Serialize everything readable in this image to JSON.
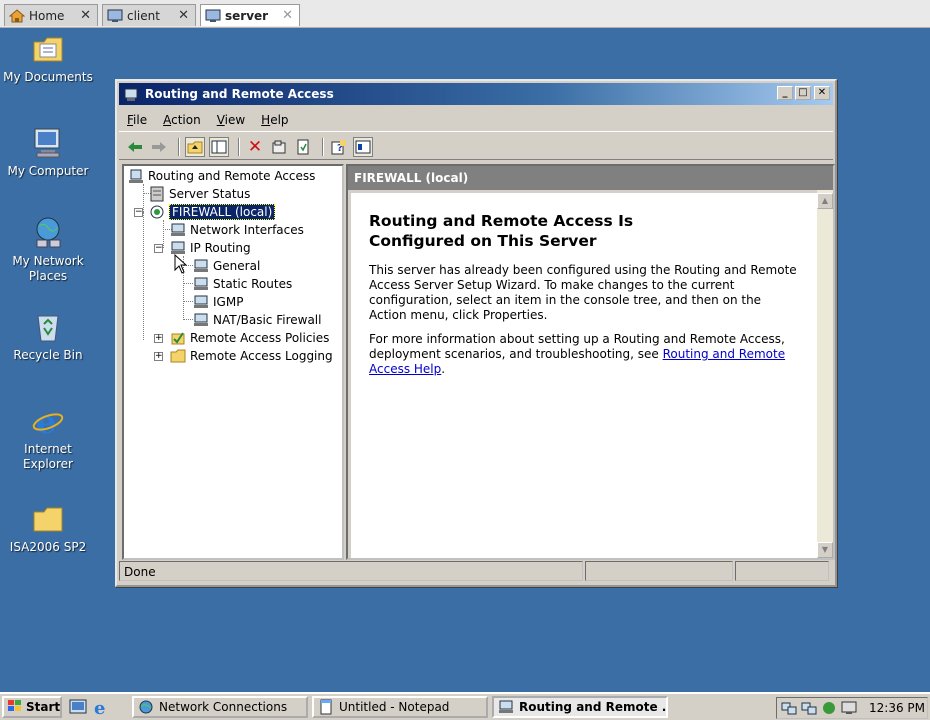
{
  "vm_tabs": [
    {
      "label": "Home",
      "icon": "home-icon",
      "active": false
    },
    {
      "label": "client",
      "icon": "vm-icon",
      "active": false
    },
    {
      "label": "server",
      "icon": "vm-icon",
      "active": true
    }
  ],
  "desktop_icons": [
    {
      "label": "My Documents",
      "icon": "folder-documents-icon"
    },
    {
      "label": "My Computer",
      "icon": "computer-icon"
    },
    {
      "label": "My Network Places",
      "icon": "network-icon"
    },
    {
      "label": "Recycle Bin",
      "icon": "recycle-bin-icon"
    },
    {
      "label": "Internet Explorer",
      "icon": "internet-explorer-icon"
    },
    {
      "label": "ISA2006 SP2",
      "icon": "folder-icon"
    }
  ],
  "window": {
    "title": "Routing and Remote Access",
    "menu": [
      "File",
      "Action",
      "View",
      "Help"
    ],
    "toolbar": [
      "back-arrow-icon",
      "forward-arrow-icon",
      "up-folder-icon",
      "show-hide-tree-icon",
      "delete-icon",
      "properties-icon",
      "export-list-icon",
      "help-icon",
      "console-tree-icon"
    ]
  },
  "tree": {
    "root": "Routing and Remote Access",
    "server_status": "Server Status",
    "server": "FIREWALL (local)",
    "network_interfaces": "Network Interfaces",
    "ip_routing": "IP Routing",
    "general": "General",
    "static_routes": "Static Routes",
    "igmp": "IGMP",
    "nat": "NAT/Basic Firewall",
    "remote_access_policies": "Remote Access Policies",
    "remote_access_logging": "Remote Access Logging"
  },
  "details": {
    "header": "FIREWALL (local)",
    "title": "Routing and Remote Access Is Configured on This Server",
    "para1": "This server has already been configured using the Routing and Remote Access Server Setup Wizard. To make changes to the current configuration, select an item in the console tree, and then on the Action menu, click Properties.",
    "para2_prefix": "For more information about setting up a Routing and Remote Access, deployment scenarios, and troubleshooting, see ",
    "para2_link": "Routing and Remote Access Help",
    "para2_suffix": "."
  },
  "status": {
    "text": "Done"
  },
  "taskbar": {
    "start": "Start",
    "buttons": [
      {
        "label": "Network Connections",
        "icon": "network-connections-icon",
        "active": false
      },
      {
        "label": "Untitled - Notepad",
        "icon": "notepad-icon",
        "active": false
      },
      {
        "label": "Routing and Remote ...",
        "icon": "rras-icon",
        "active": true
      }
    ],
    "clock": "12:36 PM"
  },
  "colors": {
    "desktop": "#3a6ea5",
    "titlebar": "#0a246a",
    "selection": "#0a246a",
    "link": "#0000cc"
  }
}
